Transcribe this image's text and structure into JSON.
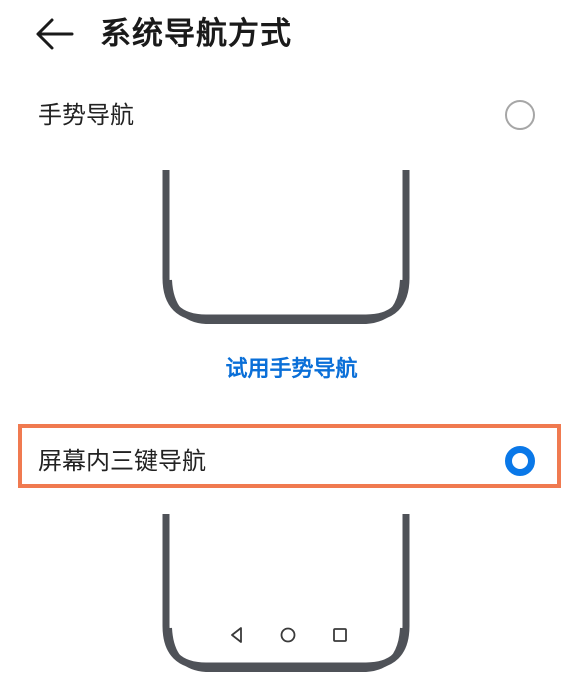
{
  "header": {
    "title": "系统导航方式"
  },
  "options": [
    {
      "label": "手势导航",
      "selected": false
    },
    {
      "label": "屏幕内三键导航",
      "selected": true
    }
  ],
  "try_gesture_link": "试用手势导航",
  "nav_keys": [
    "back-triangle-icon",
    "home-circle-icon",
    "recent-square-icon"
  ],
  "colors": {
    "accent": "#0a78e8",
    "link": "#0a6fd8",
    "highlight": "#f07a50",
    "frame": "#4f5258"
  }
}
